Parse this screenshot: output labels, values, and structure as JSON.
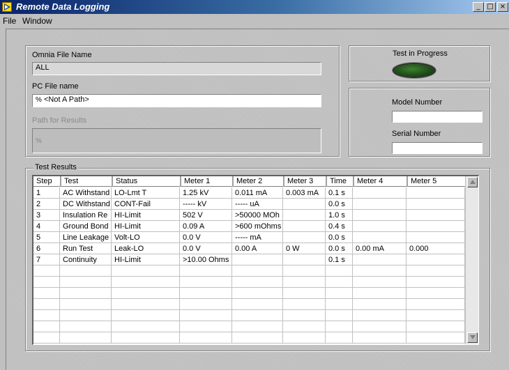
{
  "window": {
    "title": "Remote Data Logging",
    "minimize": "_",
    "maximize": "□",
    "close": "×"
  },
  "menu": [
    "File",
    "Window"
  ],
  "omnia": {
    "label": "Omnia File Name",
    "value": "ALL"
  },
  "pc_file": {
    "label": "PC File name",
    "value": "<Not A Path>",
    "prefix": "%"
  },
  "path_results": {
    "label": "Path for Results",
    "value": "",
    "prefix": "%"
  },
  "status": {
    "label": "Test in Progress"
  },
  "model": {
    "label": "Model Number",
    "value": ""
  },
  "serial": {
    "label": "Serial Number",
    "value": ""
  },
  "results": {
    "title": "Test Results",
    "columns": [
      "Step",
      "Test",
      "Status",
      "Meter 1",
      "Meter 2",
      "Meter 3",
      "Time",
      "Meter 4",
      "Meter 5"
    ],
    "rows": [
      [
        "1",
        "AC Withstand",
        "LO-Lmt T",
        "1.25 kV",
        "0.011 mA",
        "0.003 mA",
        "0.1 s",
        "",
        ""
      ],
      [
        "2",
        "DC Withstand",
        "CONT-Fail",
        "----- kV",
        "----- uA",
        "",
        "0.0 s",
        "",
        ""
      ],
      [
        "3",
        "Insulation Re",
        "HI-Limit",
        "502 V",
        ">50000 MOh",
        "",
        "1.0 s",
        "",
        ""
      ],
      [
        "4",
        "Ground Bond",
        "HI-Limit",
        "0.09 A",
        ">600 mOhms",
        "",
        "0.4 s",
        "",
        ""
      ],
      [
        "5",
        "Line Leakage",
        "Volt-LO",
        "0.0 V",
        "----- mA",
        "",
        "0.0 s",
        "",
        ""
      ],
      [
        "6",
        "Run Test",
        "Leak-LO",
        "0.0 V",
        "0.00 A",
        "0 W",
        "0.0 s",
        "0.00 mA",
        "0.000"
      ],
      [
        "7",
        "Continuity",
        "HI-Limit",
        ">10.00 Ohms",
        "",
        "",
        "0.1 s",
        "",
        ""
      ],
      [
        "",
        "",
        "",
        "",
        "",
        "",
        "",
        "",
        ""
      ],
      [
        "",
        "",
        "",
        "",
        "",
        "",
        "",
        "",
        ""
      ],
      [
        "",
        "",
        "",
        "",
        "",
        "",
        "",
        "",
        ""
      ],
      [
        "",
        "",
        "",
        "",
        "",
        "",
        "",
        "",
        ""
      ],
      [
        "",
        "",
        "",
        "",
        "",
        "",
        "",
        "",
        ""
      ],
      [
        "",
        "",
        "",
        "",
        "",
        "",
        "",
        "",
        ""
      ],
      [
        "",
        "",
        "",
        "",
        "",
        "",
        "",
        "",
        ""
      ]
    ]
  },
  "colors": {
    "led": "#1f4f1a",
    "titlebar": "#0a246a"
  }
}
